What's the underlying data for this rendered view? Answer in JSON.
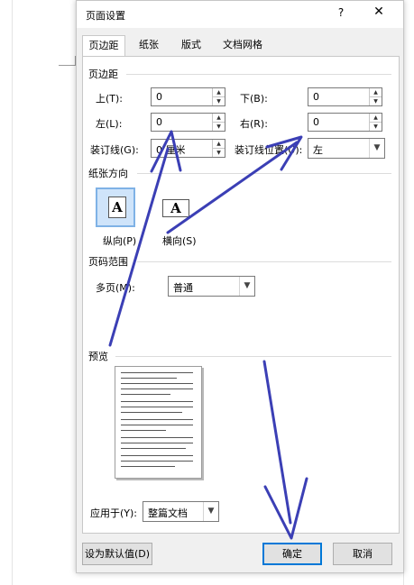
{
  "dialog": {
    "title": "页面设置",
    "help": "?",
    "close": "✕"
  },
  "tabs": [
    {
      "label": "页边距",
      "active": true
    },
    {
      "label": "纸张",
      "active": false
    },
    {
      "label": "版式",
      "active": false
    },
    {
      "label": "文档网格",
      "active": false
    }
  ],
  "margins": {
    "group_label": "页边距",
    "top_label": "上(T):",
    "top_value": "0",
    "bottom_label": "下(B):",
    "bottom_value": "0",
    "left_label": "左(L):",
    "left_value": "0",
    "right_label": "右(R):",
    "right_value": "0",
    "gutter_label": "装订线(G):",
    "gutter_value": "0 厘米",
    "gutter_pos_label": "装订线位置(U):",
    "gutter_pos_value": "左"
  },
  "orientation": {
    "group_label": "纸张方向",
    "portrait_label": "纵向(P)",
    "landscape_label": "横向(S)",
    "icon_letter": "A"
  },
  "pages": {
    "group_label": "页码范围",
    "multiple_label": "多页(M):",
    "multiple_value": "普通"
  },
  "preview": {
    "group_label": "预览"
  },
  "apply": {
    "label": "应用于(Y):",
    "value": "整篇文档"
  },
  "buttons": {
    "set_default": "设为默认值(D)",
    "ok": "确定",
    "cancel": "取消"
  },
  "colors": {
    "annotation_arrow": "#3b3fb5",
    "selected_orientation": "#cfe4fa"
  }
}
